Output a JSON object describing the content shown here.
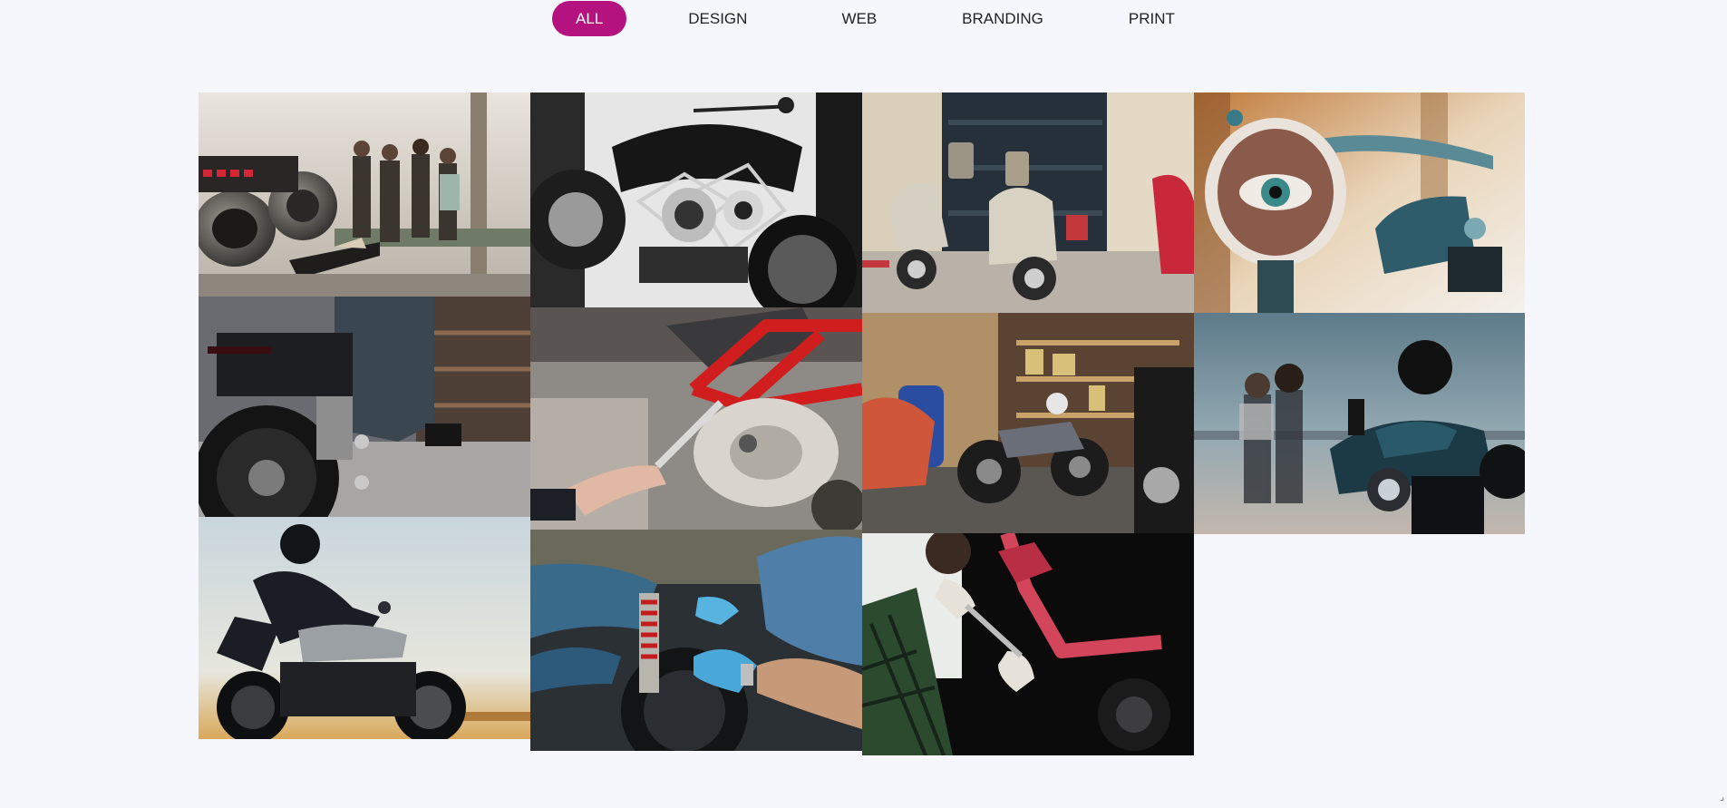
{
  "filters": [
    {
      "label": "ALL",
      "active": true
    },
    {
      "label": "DESIGN",
      "active": false
    },
    {
      "label": "WEB",
      "active": false
    },
    {
      "label": "BRANDING",
      "active": false
    },
    {
      "label": "PRINT",
      "active": false
    }
  ],
  "gallery": {
    "items": [
      {
        "subject": "riders-behind-motorcycle-exhaust"
      },
      {
        "subject": "black-and-white-motorcycle-engine"
      },
      {
        "subject": "vintage-scooters-in-garage"
      },
      {
        "subject": "motorcycle-eye-headlight-patch"
      },
      {
        "subject": "rider-on-motorcycle-in-workshop"
      },
      {
        "subject": "wrench-on-red-frame-motorcycle"
      },
      {
        "subject": "motorcycle-in-cluttered-garage"
      },
      {
        "subject": "couple-behind-blue-motorcycle"
      },
      {
        "subject": "rider-on-cafe-racer-at-sunset"
      },
      {
        "subject": "mechanics-with-gloves-repairing-suspension"
      },
      {
        "subject": "mechanic-fixing-red-motorcycle-frame"
      }
    ]
  },
  "colors": {
    "accent": "#b4127f",
    "background": "#f6f7fc"
  }
}
